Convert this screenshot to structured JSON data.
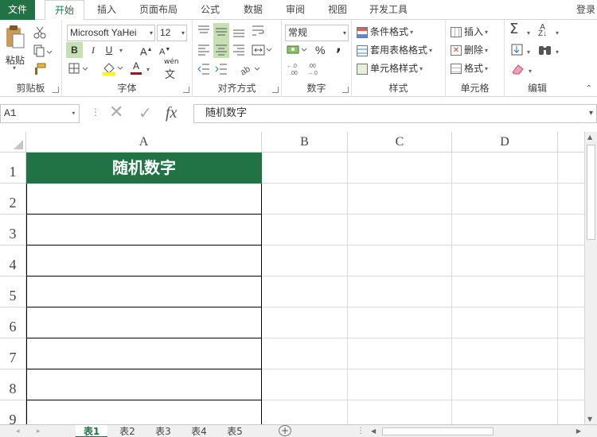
{
  "ribbon_tabs": [
    "文件",
    "开始",
    "插入",
    "页面布局",
    "公式",
    "数据",
    "审阅",
    "视图",
    "开发工具"
  ],
  "login_label": "登录",
  "clipboard": {
    "paste": "粘贴",
    "label": "剪贴板"
  },
  "font": {
    "name": "Microsoft YaHei",
    "size": "12",
    "bold": "B",
    "italic": "I",
    "underline": "U",
    "grow": "A",
    "shrink": "A",
    "color_a": "A",
    "wen": "wén",
    "label": "字体"
  },
  "alignment": {
    "label": "对齐方式"
  },
  "number": {
    "format": "常规",
    "percent": "%",
    "comma": ",",
    "label": "数字"
  },
  "styles": {
    "conditional": "条件格式",
    "table": "套用表格格式",
    "cell": "单元格样式",
    "label": "样式"
  },
  "cells": {
    "insert": "插入",
    "delete": "删除",
    "format": "格式",
    "label": "单元格"
  },
  "editing": {
    "label": "编辑"
  },
  "formula_bar": {
    "name_box": "A1",
    "fx": "fx",
    "content": "随机数字"
  },
  "columns": [
    "A",
    "B",
    "C",
    "D"
  ],
  "rows": [
    "1",
    "2",
    "3",
    "4",
    "5",
    "6",
    "7",
    "8",
    "9"
  ],
  "cell_a1": "随机数字",
  "sheets": [
    "表1",
    "表2",
    "表3",
    "表4",
    "表5"
  ],
  "colors": {
    "accent": "#217346",
    "font_color": "#c00000",
    "fill": "#ffff00"
  }
}
